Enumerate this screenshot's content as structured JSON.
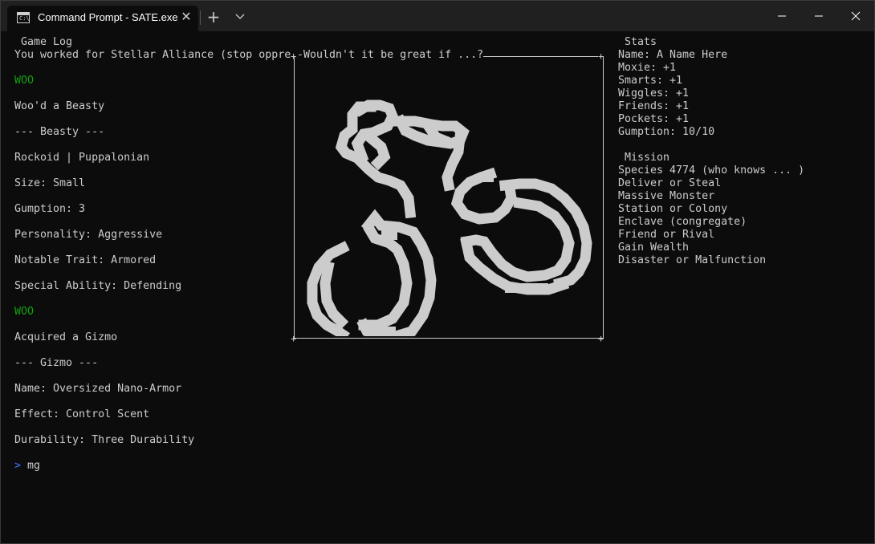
{
  "window": {
    "tab_title": "Command Prompt - SATE.exe",
    "tab_icon": "cmd-icon",
    "close_tab": "✕",
    "new_tab": "+",
    "controls": [
      "minimize-icon",
      "maximize-icon",
      "close-icon"
    ]
  },
  "game_log": {
    "header": " Game Log",
    "lines": [
      "You worked for Stellar Alliance (stop oppre",
      "WOO",
      "Woo'd a Beasty",
      "--- Beasty ---",
      "Rockoid | Puppalonian",
      "Size: Small",
      "Gumption: 3",
      "Personality: Aggressive",
      "Notable Trait: Armored",
      "Special Ability: Defending",
      "WOO",
      "Acquired a Gizmo",
      "--- Gizmo ---",
      "Name: Oversized Nano-Armor",
      "Effect: Control Scent",
      "Durability: Three Durability"
    ],
    "prompt_symbol": ">",
    "input": "mg"
  },
  "image_panel": {
    "title": "-Wouldn't it be great if ...?",
    "art": "handcuffs-ascii-art"
  },
  "stats": {
    "header": " Stats",
    "lines": [
      "Name: A Name Here",
      "Moxie: +1",
      "Smarts: +1",
      "Wiggles: +1",
      "Friends: +1",
      "Pockets: +1",
      "Gumption: 10/10"
    ]
  },
  "mission": {
    "header": " Mission",
    "lines": [
      "Species 4774 (who knows ... )",
      "Deliver or Steal",
      "Massive Monster",
      "Station or Colony",
      "Enclave (congregate)",
      "Friend or Rival",
      "Gain Wealth",
      "Disaster or Malfunction"
    ]
  },
  "colors": {
    "background": "#0c0c0c",
    "text": "#cccccc",
    "highlight_green": "#13a10e",
    "prompt_blue": "#3b78ff",
    "titlebar": "#202020"
  }
}
